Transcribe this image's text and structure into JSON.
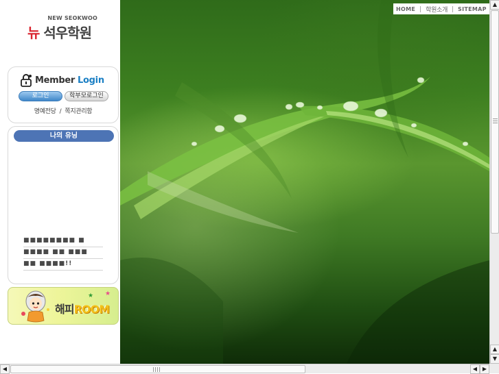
{
  "logo": {
    "english": "NEW SEOKWOO",
    "new": "뉴",
    "name": "석우학원"
  },
  "login": {
    "title_member": "Member",
    "title_login": "Login",
    "login_button": "로그인",
    "parent_login_button": "학부모로그인",
    "hall_of_fame": "명예전당",
    "separator": "/",
    "management": "쪽지관리함"
  },
  "my_study": {
    "title": "나의 유닝",
    "notice_lines": [
      "■■■■■■■■ ■",
      "■■■■ ■■ ■■■",
      "■■ ■■■■!!"
    ]
  },
  "banner": {
    "korean": "해피",
    "english": "ROOM"
  },
  "top_nav": {
    "home": "HOME",
    "about": "학원소개",
    "sitemap": "SITEMAP"
  },
  "scrollbars": {
    "up_arrow": "▲",
    "down_arrow": "▼",
    "left_arrow": "◀",
    "right_arrow": "▶",
    "vertical_position": 0.0,
    "horizontal_position": 0.0
  },
  "colors": {
    "logo_red": "#d9232d",
    "login_blue": "#1b7fc4",
    "panel_title_blue": "#4d74b5",
    "banner_yellow": "#f2c21a"
  }
}
